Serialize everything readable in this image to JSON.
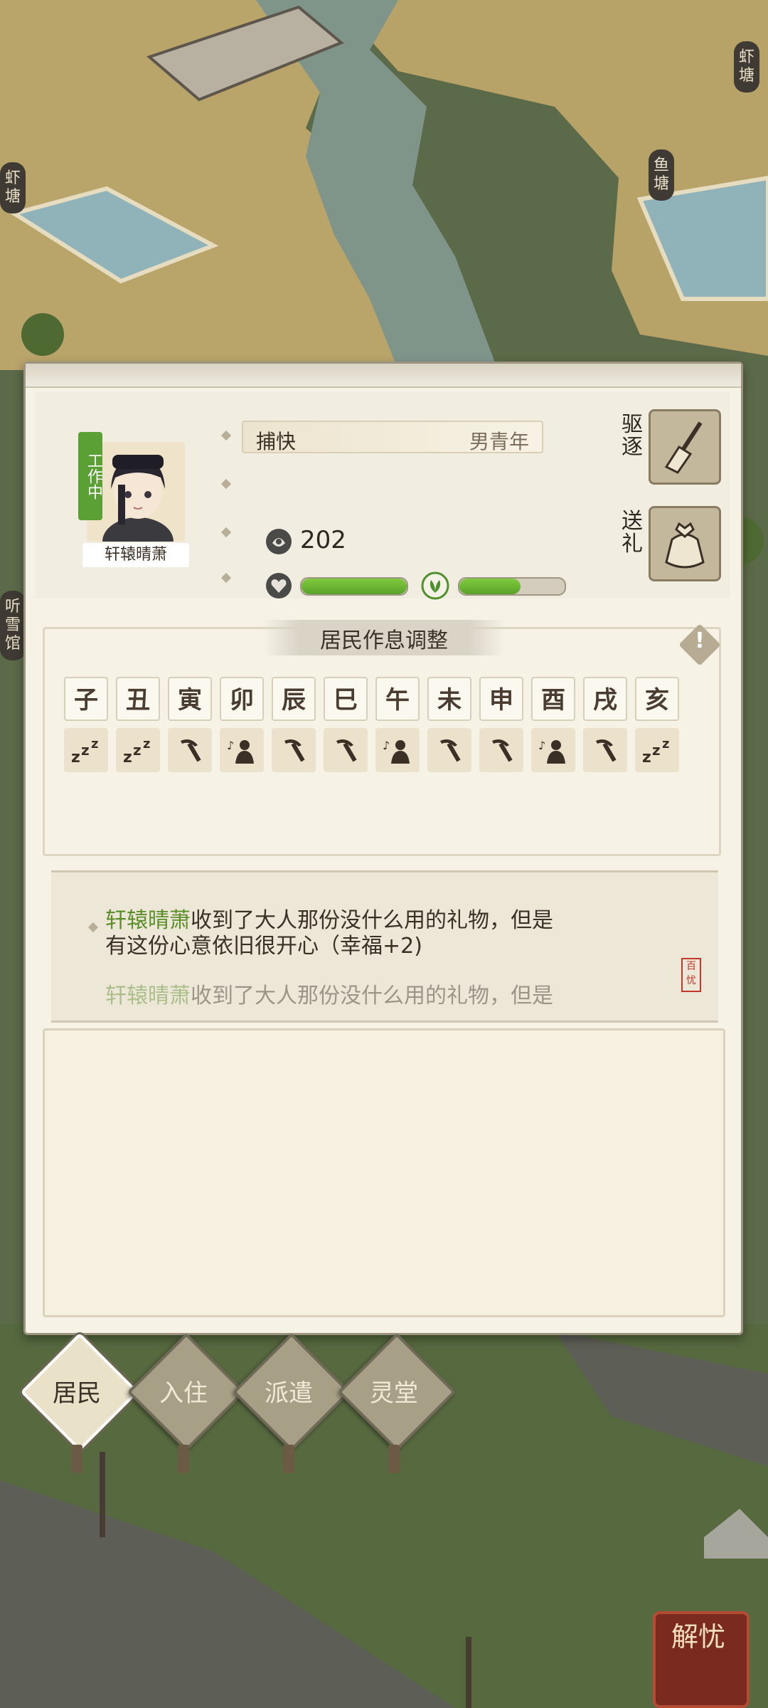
{
  "map": {
    "labels_left": [
      "虾塘",
      "听雪馆"
    ],
    "labels_right": [
      "虾塘",
      "鱼塘"
    ]
  },
  "profile": {
    "status_tag": "工作中",
    "name": "轩辕晴萧",
    "job": "捕快",
    "attributes": "男青年",
    "coins": "202",
    "health_percent": 100,
    "happiness_percent": 58,
    "dismiss_label": "驱逐",
    "gift_label": "送礼"
  },
  "schedule": {
    "title": "居民作息调整",
    "info_glyph": "!",
    "hours": [
      "子",
      "丑",
      "寅",
      "卯",
      "辰",
      "巳",
      "午",
      "未",
      "申",
      "酉",
      "戌",
      "亥"
    ],
    "activities": [
      "sleep",
      "sleep",
      "work",
      "leisure",
      "work",
      "work",
      "leisure",
      "work",
      "work",
      "leisure",
      "work",
      "sleep"
    ]
  },
  "log": {
    "entries": [
      {
        "name": "轩辕晴萧",
        "text_1": "收到了大人那份没什么用的礼物，但是",
        "text_2": "有这份心意依旧很开心（幸福+2)"
      },
      {
        "name": "轩辕晴萧",
        "text_1": "收到了大人那份没什么用的礼物，但是",
        "text_2": ""
      }
    ],
    "stamp": "百忧"
  },
  "tabs": [
    "居民",
    "入住",
    "派遣",
    "灵堂"
  ],
  "relieve_button": "解忧",
  "colors": {
    "accent_green": "#5aa034",
    "panel_bg": "#f6f2e6",
    "name_green": "#5b8e2a"
  }
}
